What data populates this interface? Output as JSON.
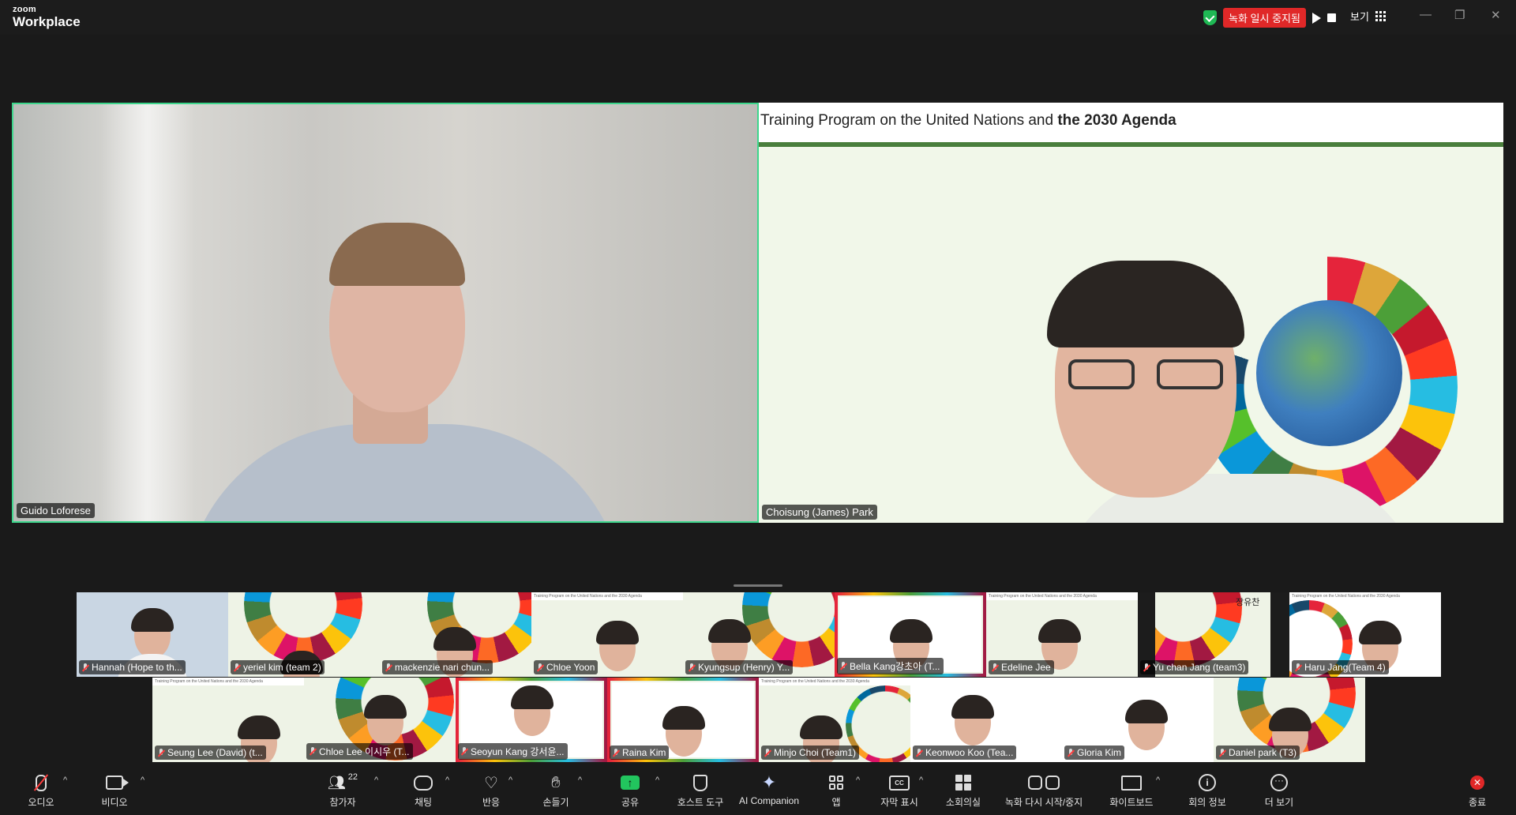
{
  "app": {
    "logo_top": "zoom",
    "logo_bottom": "Workplace"
  },
  "titlebar": {
    "recording_status": "녹화 일시 중지됨",
    "view_label": "보기",
    "minimize": "—",
    "restore": "❐",
    "close": "✕"
  },
  "main": {
    "speaker_name": "Guido Loforese",
    "share_name": "Choisung (James) Park",
    "slide_title_normal": "Training Program on the United Nations and ",
    "slide_title_bold": "the 2030 Agenda"
  },
  "participants": {
    "row1": [
      {
        "name": "Hannah (Hope to th..."
      },
      {
        "name": "yeriel kim (team 2)"
      },
      {
        "name": "mackenzie nari chun..."
      },
      {
        "name": "Chloe Yoon"
      },
      {
        "name": "Kyungsup (Henry) Y..."
      },
      {
        "name": "Bella Kang강초아 (T..."
      },
      {
        "name": "Edeline Jee"
      },
      {
        "name": "Yu chan Jang (team3)"
      },
      {
        "name": "Haru Jang(Team 4)"
      }
    ],
    "row2": [
      {
        "name": "Seung Lee (David) (t..."
      },
      {
        "name": "Chloe Lee 이시우 (T..."
      },
      {
        "name": "Seoyun Kang 강서윤..."
      },
      {
        "name": "Raina Kim"
      },
      {
        "name": "Minjo Choi (Team1)"
      },
      {
        "name": "Keonwoo Koo (Tea..."
      },
      {
        "name": "Gloria Kim"
      },
      {
        "name": "Daniel park (T3)"
      }
    ],
    "overlay_name": "장유찬",
    "slide_mini_text": "Training Program on the United Nations and the 2030 Agenda"
  },
  "toolbar": {
    "audio": "오디오",
    "video": "비디오",
    "participants": "참가자",
    "participant_count": "22",
    "chat": "채팅",
    "reactions": "반응",
    "raise_hand": "손들기",
    "share": "공유",
    "host_tools": "호스트 도구",
    "ai_companion": "AI Companion",
    "apps": "앱",
    "captions": "자막 표시",
    "breakout": "소회의실",
    "recording": "녹화 다시 시작/중지",
    "whiteboard": "화이트보드",
    "meeting_info": "회의 정보",
    "more": "더 보기",
    "end": "종료"
  },
  "colors": {
    "active_speaker": "#3dd68c",
    "recording_red": "#e02828",
    "share_green": "#22c55e"
  },
  "icons": [
    "shield-check-icon",
    "play-icon",
    "stop-icon",
    "grid-icon",
    "mic-off-icon",
    "camera-icon",
    "people-icon",
    "chat-icon",
    "heart-icon",
    "hand-icon",
    "share-arrow-icon",
    "host-shield-icon",
    "sparkle-icon",
    "apps-icon",
    "cc-icon",
    "breakout-icon",
    "record-icon",
    "whiteboard-icon",
    "info-icon",
    "more-icon",
    "end-icon"
  ]
}
